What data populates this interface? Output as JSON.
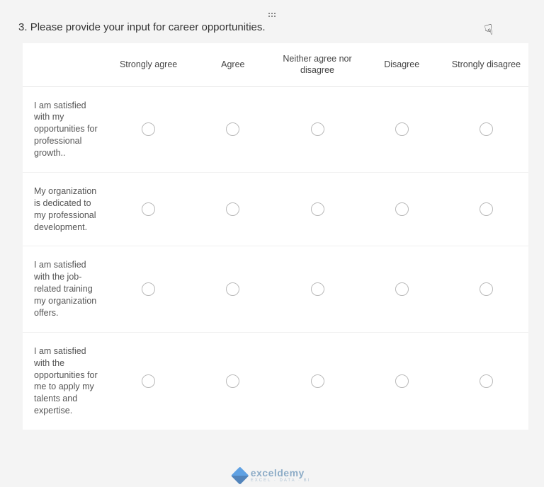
{
  "question": {
    "number": "3.",
    "text": "Please provide your input for career opportunities."
  },
  "columns": [
    "Strongly agree",
    "Agree",
    "Neither agree nor disagree",
    "Disagree",
    "Strongly disagree"
  ],
  "rows": [
    "I am satisfied with my opportunities for professional growth..",
    "My organization is dedicated to my professional development.",
    "I am satisfied with the job-related training my organization offers.",
    "I am satisfied with the opportunities for me to apply my talents and expertise."
  ],
  "watermark": {
    "brand": "exceldemy",
    "tagline": "EXCEL · DATA · BI"
  }
}
